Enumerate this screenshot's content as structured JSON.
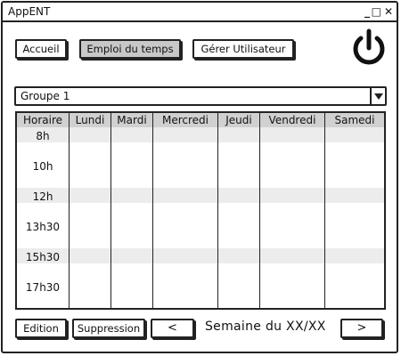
{
  "window": {
    "title": "AppENT",
    "controls": {
      "minimize": "_",
      "maximize": "□",
      "close": "✕"
    }
  },
  "nav": {
    "accueil": "Accueil",
    "emploi": "Emploi du temps",
    "gerer": "Gérer Utilisateur",
    "power_icon": "power-icon"
  },
  "group_select": {
    "value": "Groupe 1"
  },
  "schedule": {
    "columns": [
      "Horaire",
      "Lundi",
      "Mardi",
      "Mercredi",
      "Jeudi",
      "Vendredi",
      "Samedi"
    ],
    "hours": [
      "8h",
      "10h",
      "12h",
      "13h30",
      "15h30",
      "17h30"
    ]
  },
  "footer": {
    "edition": "Edition",
    "suppression": "Suppression",
    "prev": "<",
    "week_label": "Semaine du XX/XX",
    "next": ">"
  },
  "colors": {
    "active_button": "#c8c8c8",
    "row_band": "#ececec",
    "header_band": "#d0d0d0"
  }
}
